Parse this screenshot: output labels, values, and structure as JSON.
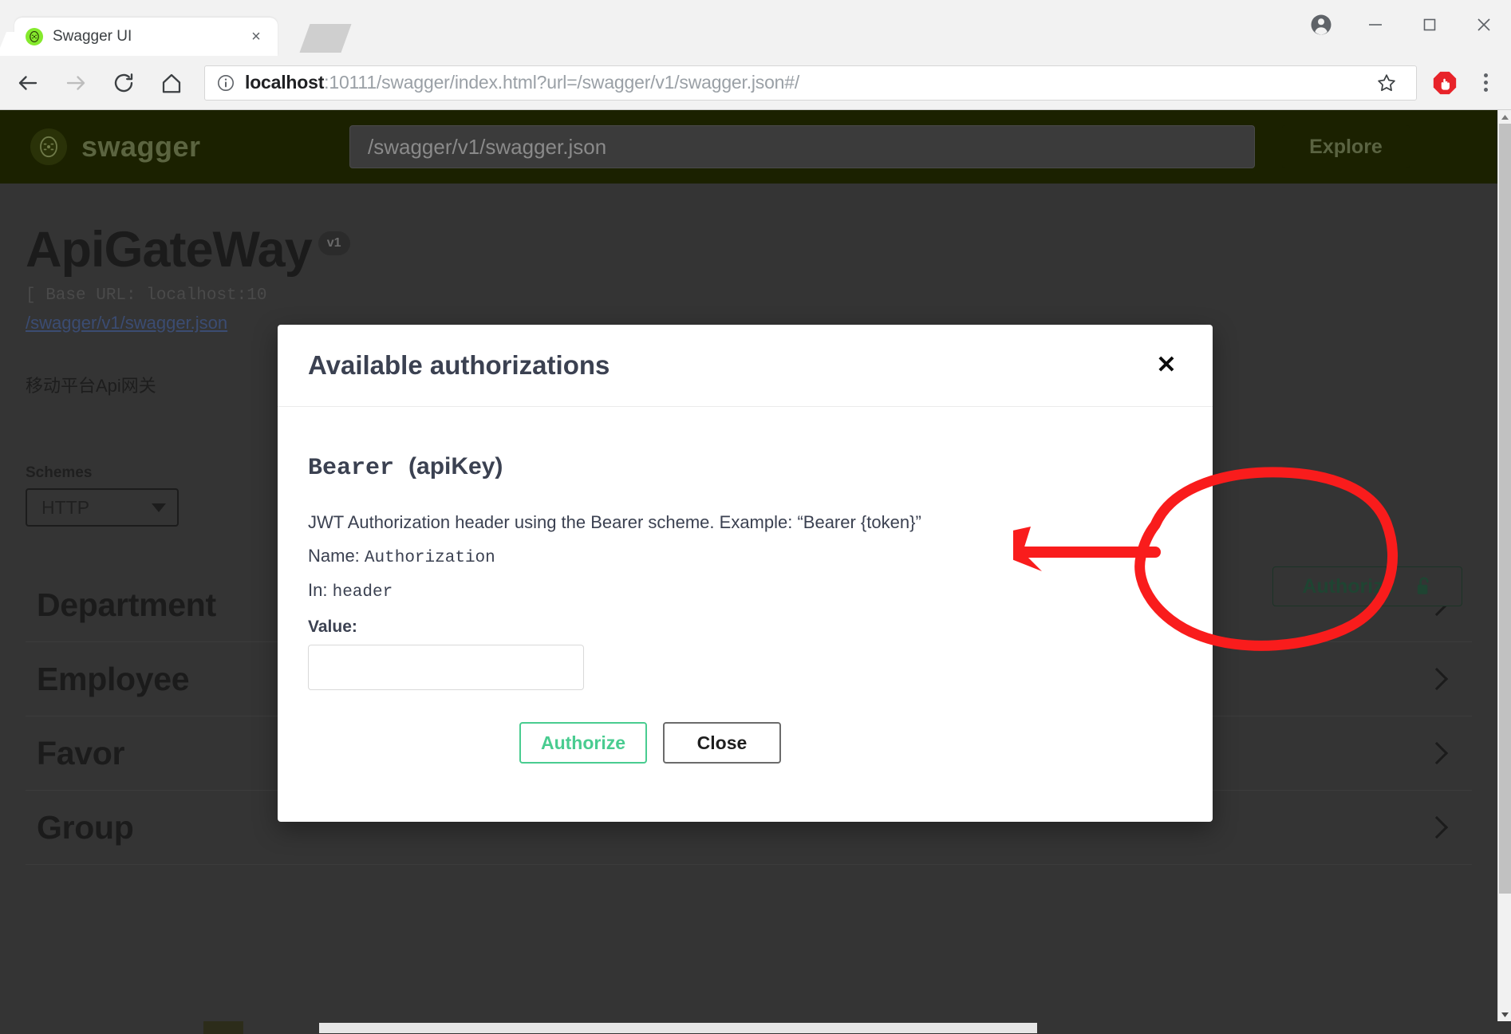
{
  "browser": {
    "tab": {
      "title": "Swagger UI",
      "favicon": "swagger-favicon",
      "close": "×"
    },
    "nav": {
      "back": "back-arrow",
      "forward": "forward-arrow",
      "reload": "reload",
      "home": "home"
    },
    "omnibox": {
      "url_host": "localhost",
      "url_rest": ":10111/swagger/index.html?url=/swagger/v1/swagger.json#/",
      "full_url": "localhost:10111/swagger/index.html?url=/swagger/v1/swagger.json#/",
      "info_icon": "site-info-icon",
      "star_icon": "bookmark-star-icon",
      "extension_icon": "adblock-icon",
      "menu_icon": "chrome-menu-icon"
    },
    "window_controls": {
      "profile": "profile-icon",
      "minimize": "—",
      "maximize": "□",
      "close": "✕"
    }
  },
  "swagger_topbar": {
    "logo_text": "swagger",
    "logo_mark": "{...}",
    "spec_url_value": "/swagger/v1/swagger.json",
    "spec_url_placeholder": "/swagger/v1/swagger.json",
    "explore_label": "Explore"
  },
  "api_info": {
    "title": "ApiGateWay",
    "version_badge": "v1",
    "base_url": "[ Base URL: localhost:10",
    "spec_link": "/swagger/v1/swagger.json",
    "description": "移动平台Api网关"
  },
  "schemes": {
    "label": "Schemes",
    "selected": "HTTP",
    "options": [
      "HTTP"
    ],
    "chevron": "chevron-down-icon"
  },
  "authorize": {
    "label": "Authorize",
    "lock_icon": "unlocked-padlock-icon"
  },
  "tags": [
    {
      "name": "Department",
      "chevron": "chevron-right-icon"
    },
    {
      "name": "Employee",
      "chevron": "chevron-right-icon"
    },
    {
      "name": "Favor",
      "chevron": "chevron-right-icon"
    },
    {
      "name": "Group",
      "chevron": "chevron-right-icon"
    }
  ],
  "modal": {
    "title": "Available authorizations",
    "close_glyph": "✕",
    "scheme": {
      "name": "Bearer",
      "type": "(apiKey)",
      "description": "JWT Authorization header using the Bearer scheme. Example: “Bearer {token}”",
      "name_line_label": "Name:",
      "name_line_value": "Authorization",
      "in_line_label": "In:",
      "in_line_value": "header"
    },
    "value_label": "Value:",
    "value_input": "",
    "value_placeholder": "",
    "authorize_button": "Authorize",
    "close_button": "Close"
  },
  "annotation": {
    "shape": "red-ellipse-and-arrow",
    "color": "#f91c1c",
    "target": "authorize-button"
  },
  "colors": {
    "swagger_green": "#85ea2d",
    "authorize_green": "#49cc90",
    "topbar_bg": "#1b2100",
    "page_bg": "#343434",
    "annotation_red": "#f91c1c"
  },
  "scrollbars": {
    "vertical": "vertical-scrollbar",
    "horizontal": "horizontal-scrollbar"
  }
}
